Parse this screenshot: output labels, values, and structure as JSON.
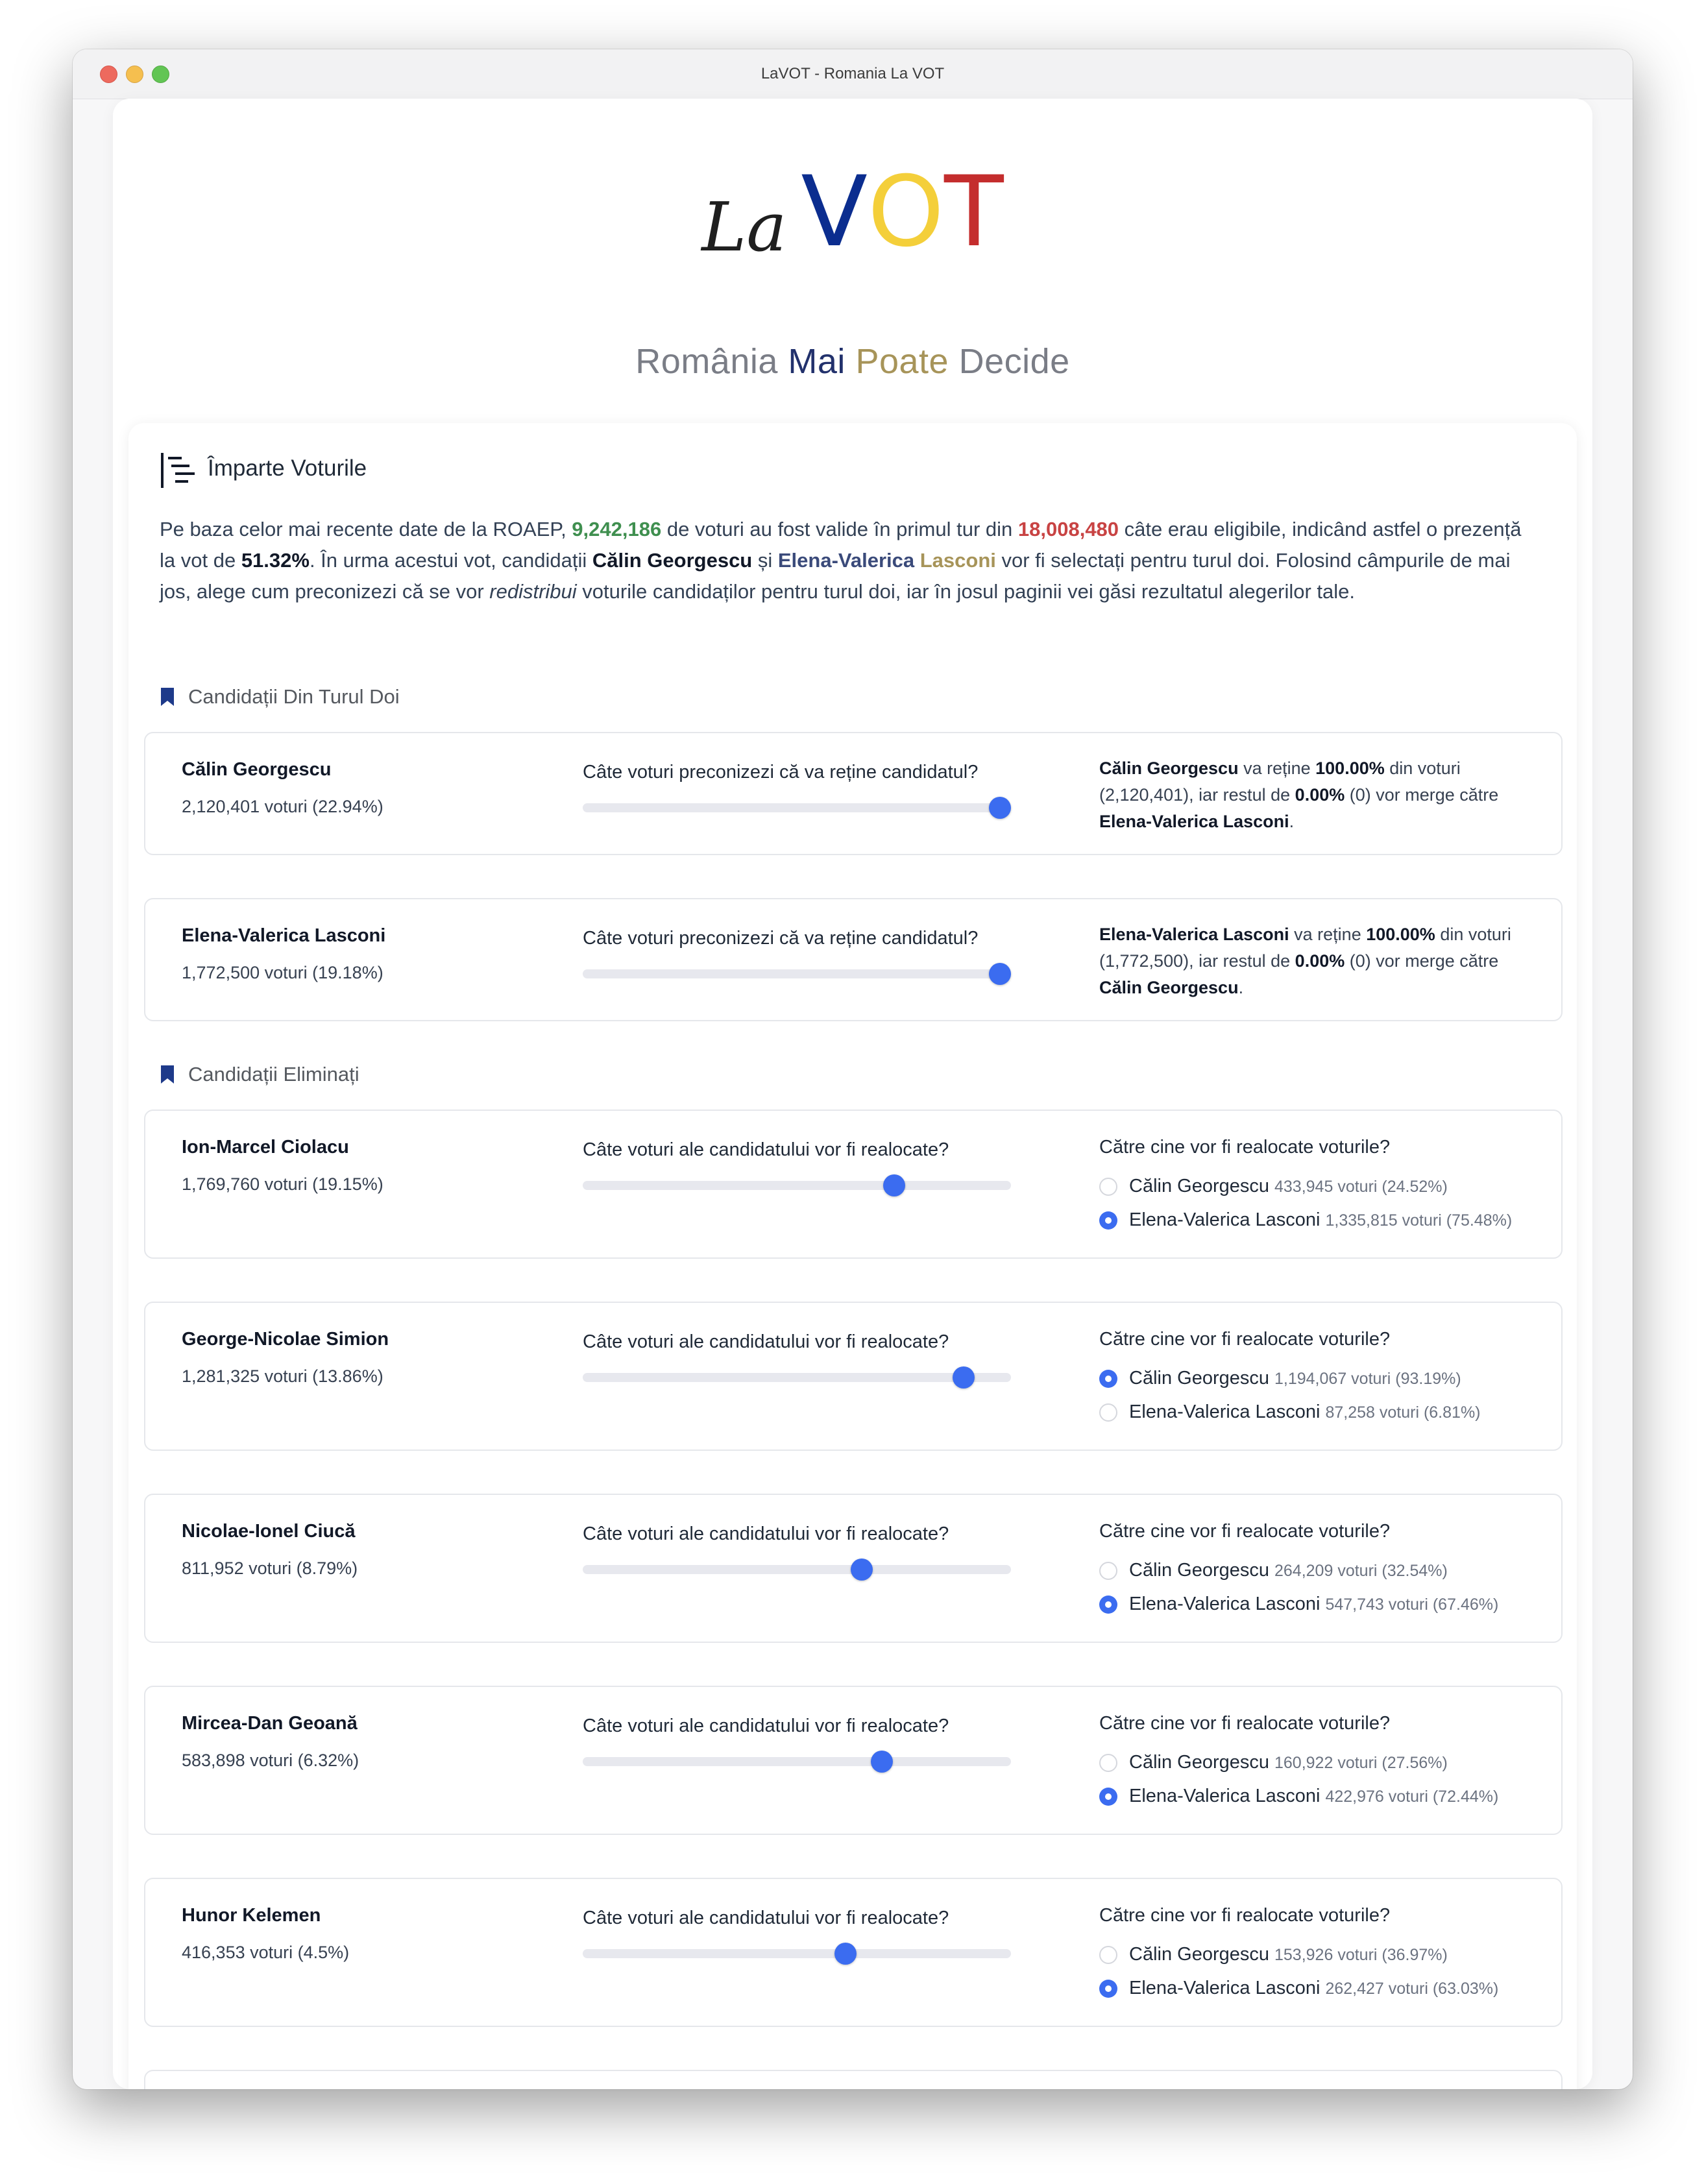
{
  "window": {
    "title": "LaVOT - Romania La VOT"
  },
  "logo": {
    "la": "La",
    "v": "V",
    "o": "O",
    "t": "T"
  },
  "tagline": {
    "w1": "România",
    "w2": "Mai",
    "w3": "Poate",
    "w4": "Decide"
  },
  "card": {
    "title": "Împarte Voturile",
    "icon": "split-list-icon"
  },
  "intro": {
    "p1": "Pe baza celor mai recente date de la ROAEP, ",
    "valid_votes": "9,242,186",
    "p2": " de voturi au fost valide în primul tur din ",
    "eligible_votes": "18,008,480",
    "p3": " câte erau eligibile, indicând astfel o prezență la vot de ",
    "turnout": "51.32%",
    "p4": ". În urma acestui vot, candidații ",
    "cand1": "Călin Georgescu",
    "p5": " și ",
    "cand2_first": "Elena-Valerica",
    "cand2_last": " Lasconi",
    "p6": " vor fi selectați pentru turul doi. Folosind câmpurile de mai jos, alege cum preconizezi că se vor ",
    "emph": "redistribui",
    "p7": " voturile candidaților pentru turul doi, iar în josul paginii vei găsi rezultatul alegerilor tale."
  },
  "sections": {
    "round2": "Candidații Din Turul Doi",
    "eliminated": "Candidații Eliminați"
  },
  "labels": {
    "retain_question": "Câte voturi preconizezi că va reține candidatul?",
    "realloc_question": "Câte voturi ale candidatului vor fi realocate?",
    "dest_question": "Către cine vor fi realocate voturile?",
    "votes_word": "voturi"
  },
  "finalists": [
    {
      "name": "Călin Georgescu",
      "votes": "2,120,401 voturi (22.94%)",
      "retain_fraction": 1.0,
      "s1": " va reține ",
      "pct": "100.00%",
      "s2": " din voturi (2,120,401), iar restul de ",
      "rest": "0.00%",
      "s3": " (0) vor merge către ",
      "other": "Elena-Valerica Lasconi",
      "s4": "."
    },
    {
      "name": "Elena-Valerica Lasconi",
      "votes": "1,772,500 voturi (19.18%)",
      "retain_fraction": 1.0,
      "s1": " va reține ",
      "pct": "100.00%",
      "s2": " din voturi (1,772,500), iar restul de ",
      "rest": "0.00%",
      "s3": " (0) vor merge către ",
      "other": "Călin Georgescu",
      "s4": "."
    }
  ],
  "eliminated": [
    {
      "name": "Ion-Marcel Ciolacu",
      "votes": "1,769,760 voturi (19.15%)",
      "realloc_fraction": 0.74,
      "options": [
        {
          "name": "Călin Georgescu",
          "meta": "433,945 voturi (24.52%)",
          "selected": false
        },
        {
          "name": "Elena-Valerica Lasconi",
          "meta": "1,335,815 voturi (75.48%)",
          "selected": true
        }
      ]
    },
    {
      "name": "George-Nicolae Simion",
      "votes": "1,281,325 voturi (13.86%)",
      "realloc_fraction": 0.91,
      "options": [
        {
          "name": "Călin Georgescu",
          "meta": "1,194,067 voturi (93.19%)",
          "selected": true
        },
        {
          "name": "Elena-Valerica Lasconi",
          "meta": "87,258 voturi (6.81%)",
          "selected": false
        }
      ]
    },
    {
      "name": "Nicolae-Ionel Ciucă",
      "votes": "811,952 voturi (8.79%)",
      "realloc_fraction": 0.66,
      "options": [
        {
          "name": "Călin Georgescu",
          "meta": "264,209 voturi (32.54%)",
          "selected": false
        },
        {
          "name": "Elena-Valerica Lasconi",
          "meta": "547,743 voturi (67.46%)",
          "selected": true
        }
      ]
    },
    {
      "name": "Mircea-Dan Geoană",
      "votes": "583,898 voturi (6.32%)",
      "realloc_fraction": 0.71,
      "options": [
        {
          "name": "Călin Georgescu",
          "meta": "160,922 voturi (27.56%)",
          "selected": false
        },
        {
          "name": "Elena-Valerica Lasconi",
          "meta": "422,976 voturi (72.44%)",
          "selected": true
        }
      ]
    },
    {
      "name": "Hunor Kelemen",
      "votes": "416,353 voturi (4.5%)",
      "realloc_fraction": 0.62,
      "options": [
        {
          "name": "Călin Georgescu",
          "meta": "153,926 voturi (36.97%)",
          "selected": false
        },
        {
          "name": "Elena-Valerica Lasconi",
          "meta": "262,427 voturi (63.03%)",
          "selected": true
        }
      ]
    }
  ],
  "colors": {
    "accent": "#3b6cf0",
    "green": "#3f8f4f",
    "red": "#c84343",
    "navy": "#0b2d8f",
    "yellow": "#f4cf3a",
    "flag_red": "#c42d2d"
  }
}
